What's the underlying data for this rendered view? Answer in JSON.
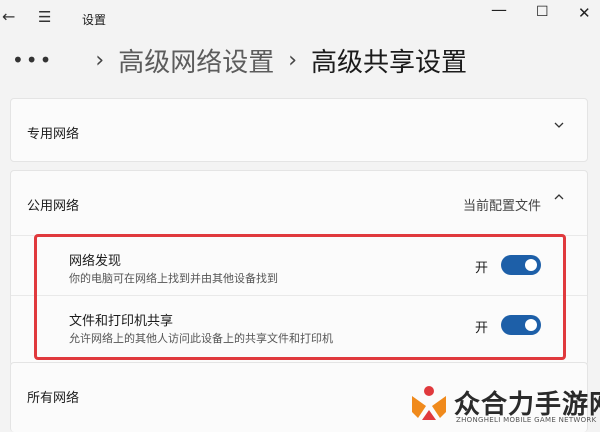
{
  "window": {
    "title": "设置",
    "back_icon": "back-arrow-icon",
    "menu_icon": "hamburger-menu-icon",
    "minimize_glyph": "—",
    "maximize_glyph": "☐",
    "close_glyph": "✕"
  },
  "breadcrumb": {
    "more": "•••",
    "separator": "›",
    "parent": "高级网络设置",
    "current": "高级共享设置"
  },
  "sections": {
    "private": {
      "label": "专用网络",
      "expanded": false
    },
    "public": {
      "label": "公用网络",
      "profile_label": "当前配置文件",
      "expanded": true,
      "settings": [
        {
          "title": "网络发现",
          "description": "你的电脑可在网络上找到并由其他设备找到",
          "state_label": "开",
          "on": true
        },
        {
          "title": "文件和打印机共享",
          "description": "允许网络上的其他人访问此设备上的共享文件和打印机",
          "state_label": "开",
          "on": true
        }
      ]
    },
    "all": {
      "label": "所有网络"
    }
  },
  "logo": {
    "name_cn": "众合力手游网",
    "name_en": "ZHONGHELI MOBILE GAME NETWORK"
  },
  "colors": {
    "accent": "#1d5fa8",
    "highlight": "#e0393d",
    "logo_orange": "#f08a1c",
    "logo_red": "#e0393d"
  }
}
